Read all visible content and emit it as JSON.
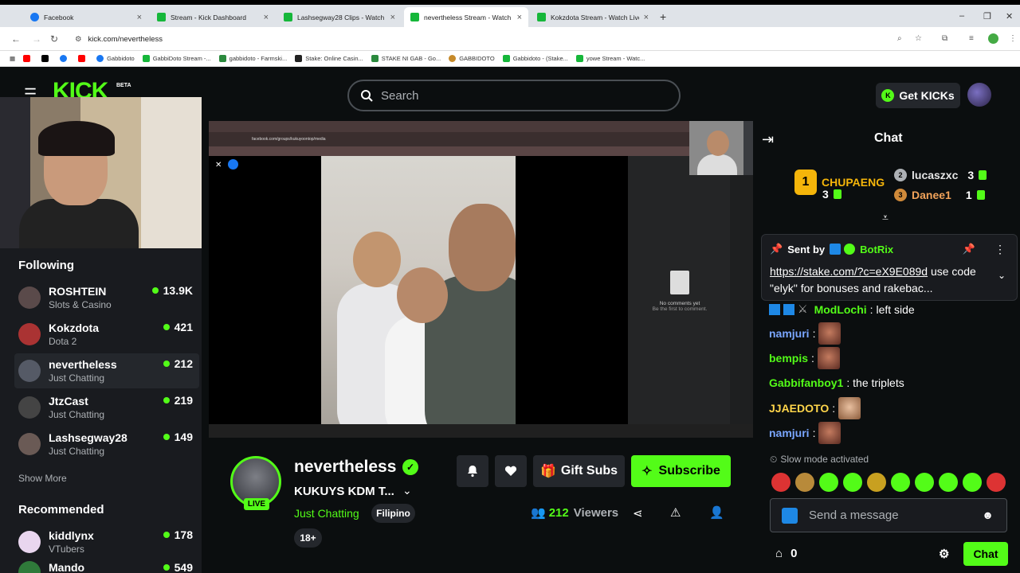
{
  "browser": {
    "tabs": [
      {
        "label": "Facebook",
        "favicon": "facebook"
      },
      {
        "label": "Stream - Kick Dashboard",
        "favicon": "kick"
      },
      {
        "label": "Lashsegway28 Clips - Watch Liv",
        "favicon": "kick"
      },
      {
        "label": "nevertheless Stream - Watch Liv",
        "favicon": "kick"
      },
      {
        "label": "Kokzdota Stream - Watch Live o",
        "favicon": "kick"
      }
    ],
    "url": "kick.com/nevertheless",
    "bookmarks": [
      "Gabbidoto",
      "GabbiDoto Stream -...",
      "gabbidoto - Farmski...",
      "Stake: Online Casin...",
      "STAKE NI GAB - Go...",
      "GABBIDOTO",
      "Gabbidoto - (Stake...",
      "yowe Stream - Watc..."
    ]
  },
  "header": {
    "logo": "KICK",
    "beta": "BETA",
    "search_placeholder": "Search",
    "get_kicks": "Get KICKs"
  },
  "sidebar": {
    "following_title": "Following",
    "following": [
      {
        "name": "ROSHTEIN",
        "category": "Slots & Casino",
        "viewers": "13.9K"
      },
      {
        "name": "Kokzdota",
        "category": "Dota 2",
        "viewers": "421"
      },
      {
        "name": "nevertheless",
        "category": "Just Chatting",
        "viewers": "212"
      },
      {
        "name": "JtzCast",
        "category": "Just Chatting",
        "viewers": "219"
      },
      {
        "name": "Lashsegway28",
        "category": "Just Chatting",
        "viewers": "149"
      }
    ],
    "show_more": "Show More",
    "recommended_title": "Recommended",
    "recommended": [
      {
        "name": "kiddlynx",
        "category": "VTubers",
        "viewers": "178"
      },
      {
        "name": "Mando",
        "category": "",
        "viewers": "549"
      }
    ]
  },
  "video": {
    "inner_url": "facebook.com/groups/kukuyoontop/media",
    "no_comments": "No comments yet",
    "be_first": "Be the first to comment."
  },
  "stream_info": {
    "channel": "nevertheless",
    "live": "LIVE",
    "title": "KUKUYS KDM T...",
    "category": "Just Chatting",
    "language": "Filipino",
    "rating": "18+",
    "gift_subs": "Gift Subs",
    "subscribe": "Subscribe",
    "viewers_count": "212",
    "viewers_label": "Viewers"
  },
  "chat": {
    "title": "Chat",
    "leaderboard": [
      {
        "rank": "1",
        "name": "CHUPAENG",
        "gifts": "3"
      },
      {
        "rank": "2",
        "name": "lucaszxc",
        "gifts": "3"
      },
      {
        "rank": "3",
        "name": "Danee1",
        "gifts": "1"
      }
    ],
    "pinned": {
      "sent_by": "Sent by",
      "bot": "BotRix",
      "link": "https://stake.com/?c=eX9E089d",
      "text": " use code \"elyk\" for bonuses and rakebac..."
    },
    "messages": [
      {
        "user": "ModLochi",
        "text": "left side",
        "color": "#53fc18"
      },
      {
        "user": "namjuri",
        "text": "",
        "color": "#7aa6ff"
      },
      {
        "user": "bempis",
        "text": "",
        "color": "#53fc18"
      },
      {
        "user": "Gabbifanboy1",
        "text": "the triplets",
        "color": "#53fc18"
      },
      {
        "user": "JJAEDOTO",
        "text": "",
        "color": "#ffd54a"
      },
      {
        "user": "namjuri",
        "text": "",
        "color": "#7aa6ff"
      }
    ],
    "slow_mode": "Slow mode activated",
    "input_placeholder": "Send a message",
    "kicks_count": "0",
    "chat_button": "Chat"
  },
  "colors": {
    "accent": "#53fc18",
    "bg": "#0b0e0f",
    "panel": "#191b1f"
  }
}
